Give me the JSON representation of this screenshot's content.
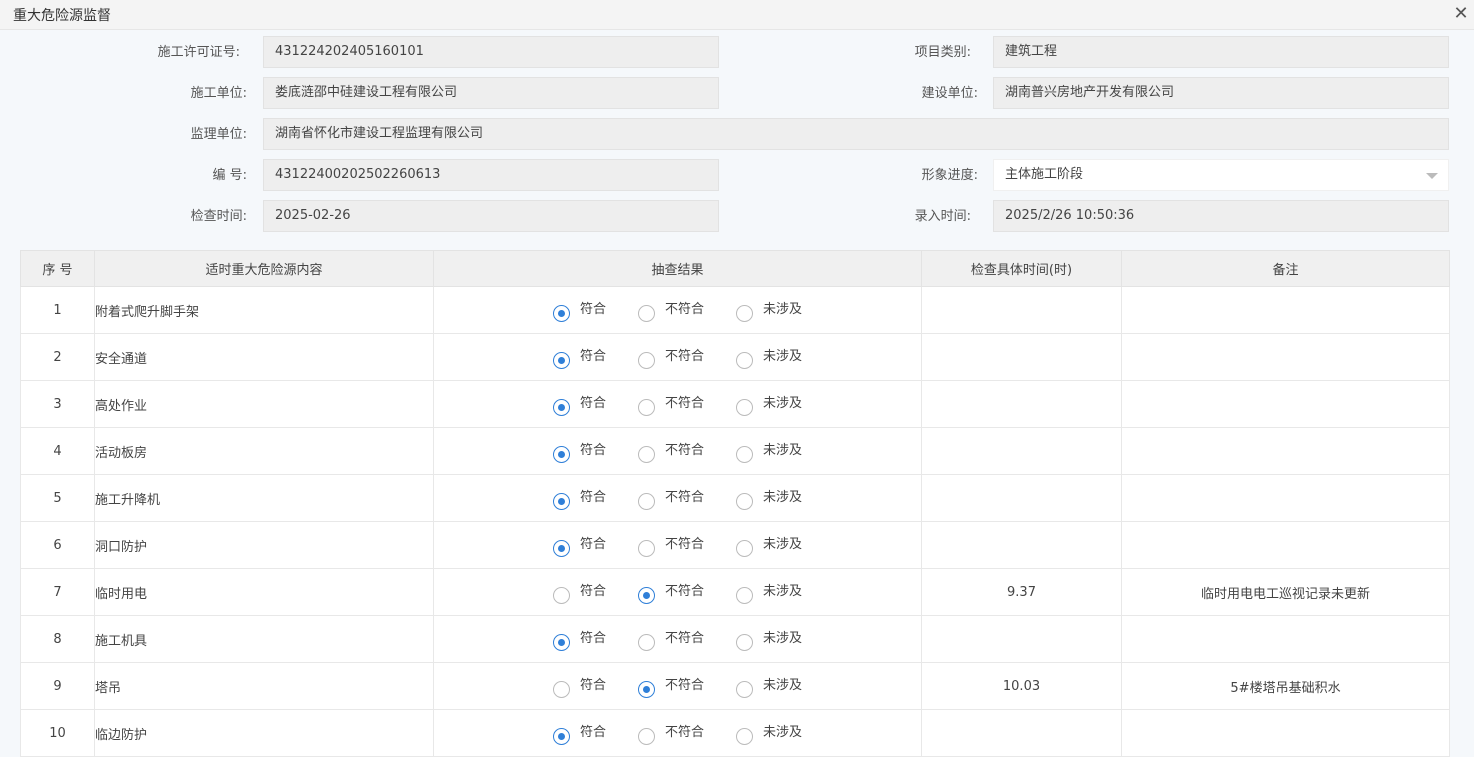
{
  "window": {
    "title": "重大危险源监督",
    "close_label": "✕"
  },
  "form": {
    "permit_label": "施工许可证号:",
    "permit_value": "431224202405160101",
    "project_type_label": "项目类别:",
    "project_type_value": "建筑工程",
    "construction_unit_label": "施工单位:",
    "construction_unit_value": "娄底涟邵中硅建设工程有限公司",
    "builder_unit_label": "建设单位:",
    "builder_unit_value": "湖南普兴房地产开发有限公司",
    "supervision_unit_label": "监理单位:",
    "supervision_unit_value": "湖南省怀化市建设工程监理有限公司",
    "number_label": "编 号:",
    "number_value": "43122400202502260613",
    "progress_label": "形象进度:",
    "progress_value": "主体施工阶段",
    "check_time_label": "检查时间:",
    "check_time_value": "2025-02-26",
    "entry_time_label": "录入时间:",
    "entry_time_value": "2025/2/26 10:50:36"
  },
  "table": {
    "headers": [
      "序 号",
      "适时重大危险源内容",
      "抽查结果",
      "检查具体时间(时)",
      "备注"
    ],
    "options": [
      "符合",
      "不符合",
      "未涉及"
    ],
    "rows": [
      {
        "idx": "1",
        "name": "附着式爬升脚手架",
        "result": "符合",
        "time": "",
        "note": ""
      },
      {
        "idx": "2",
        "name": "安全通道",
        "result": "符合",
        "time": "",
        "note": ""
      },
      {
        "idx": "3",
        "name": "高处作业",
        "result": "符合",
        "time": "",
        "note": ""
      },
      {
        "idx": "4",
        "name": "活动板房",
        "result": "符合",
        "time": "",
        "note": ""
      },
      {
        "idx": "5",
        "name": "施工升降机",
        "result": "符合",
        "time": "",
        "note": ""
      },
      {
        "idx": "6",
        "name": "洞口防护",
        "result": "符合",
        "time": "",
        "note": ""
      },
      {
        "idx": "7",
        "name": "临时用电",
        "result": "不符合",
        "time": "9.37",
        "note": "临时用电电工巡视记录未更新"
      },
      {
        "idx": "8",
        "name": "施工机具",
        "result": "符合",
        "time": "",
        "note": ""
      },
      {
        "idx": "9",
        "name": "塔吊",
        "result": "不符合",
        "time": "10.03",
        "note": "5#楼塔吊基础积水"
      },
      {
        "idx": "10",
        "name": "临边防护",
        "result": "符合",
        "time": "",
        "note": ""
      }
    ]
  }
}
